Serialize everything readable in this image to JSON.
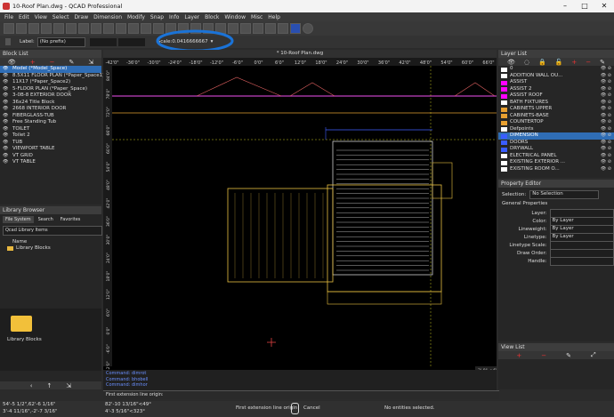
{
  "app": {
    "title": "10-Roof  Plan.dwg - QCAD Professional"
  },
  "menu": [
    "File",
    "Edit",
    "View",
    "Select",
    "Draw",
    "Dimension",
    "Modify",
    "Snap",
    "Info",
    "Layer",
    "Block",
    "Window",
    "Misc",
    "Help"
  ],
  "options": {
    "label_caption": "Label:",
    "label_value": "(No prefix)",
    "scale_caption": "Scale:",
    "scale_value": "0.0416666667"
  },
  "doc_tab": "* 10-Roof  Plan.dwg",
  "ruler_top": [
    "-42'0\"",
    "-36'0\"",
    "-30'0\"",
    "-24'0\"",
    "-18'0\"",
    "-12'0\"",
    "-6'0\"",
    "0'0\"",
    "6'0\"",
    "12'0\"",
    "18'0\"",
    "24'0\"",
    "30'0\"",
    "36'0\"",
    "42'0\"",
    "48'0\"",
    "54'0\"",
    "60'0\"",
    "66'0\""
  ],
  "ruler_left": [
    "84'0\"",
    "78'0\"",
    "72'0\"",
    "66'0\"",
    "60'0\"",
    "54'0\"",
    "48'0\"",
    "42'0\"",
    "36'0\"",
    "30'0\"",
    "24'0\"",
    "18'0\"",
    "12'0\"",
    "6'0\"",
    "0'0\"",
    "-6'0\"",
    "-12'0\""
  ],
  "block_list": {
    "title": "Block List",
    "items": [
      "Model (*Model_Space)",
      "8.5X11 FLOOR PLAN (*Paper_Space1)",
      "11X17 (*Paper_Space2)",
      "5-FLOOR PLAN (*Paper_Space)",
      "3-0B-8 EXTERIOR DOOR",
      "36x24 Title Block",
      "2668 INTERIOR DOOR",
      "FIBERGLASS-TUB",
      "Free Standing Tub",
      "TOILET",
      "Toilet 2",
      "TUB",
      "VIEWPORT TABLE",
      "VT GRID",
      "VT TABLE"
    ]
  },
  "library": {
    "title": "Library Browser",
    "tabs": [
      "File System",
      "Search",
      "Favorites"
    ],
    "source": "Qcad Library Items",
    "col_name": "Name",
    "tree_item": "Library Blocks",
    "preview_label": "Library Blocks"
  },
  "layer_list": {
    "title": "Layer List",
    "items": [
      {
        "name": "0",
        "color": "#ffffff"
      },
      {
        "name": "ADDITION WALL OU...",
        "color": "#ffffff"
      },
      {
        "name": "ASSIST",
        "color": "#ff00ff"
      },
      {
        "name": "ASSIST 2",
        "color": "#ff00ff"
      },
      {
        "name": "ASSIST ROOF",
        "color": "#ff00ff"
      },
      {
        "name": "BATH FIXTURES",
        "color": "#ffffff"
      },
      {
        "name": "CABINETS UPPER",
        "color": "#e8a030"
      },
      {
        "name": "CABINETS-BASE",
        "color": "#e8a030"
      },
      {
        "name": "COUNTERTOP",
        "color": "#e8a030"
      },
      {
        "name": "Defpoints",
        "color": "#ffffff"
      },
      {
        "name": "DIMENSION",
        "color": "#3a5dff"
      },
      {
        "name": "DOORS",
        "color": "#3a5dff"
      },
      {
        "name": "DRYWALL",
        "color": "#3a5dff"
      },
      {
        "name": "ELECTRICAL PANEL",
        "color": "#ffffff"
      },
      {
        "name": "EXISTING EXTERIOR ...",
        "color": "#ffffff"
      },
      {
        "name": "EXISTING ROOM O...",
        "color": "#ffffff"
      }
    ],
    "selected": 10
  },
  "property_editor": {
    "title": "Property Editor",
    "selection_caption": "Selection:",
    "selection_value": "No Selection",
    "group": "General Properties",
    "rows": [
      {
        "k": "Layer:",
        "v": ""
      },
      {
        "k": "Color:",
        "v": "By Layer"
      },
      {
        "k": "Lineweight:",
        "v": "By Layer"
      },
      {
        "k": "Linetype:",
        "v": "By Layer"
      },
      {
        "k": "Linetype Scale:",
        "v": ""
      },
      {
        "k": "Draw Order:",
        "v": ""
      },
      {
        "k": "Handle:",
        "v": ""
      }
    ]
  },
  "view_list": {
    "title": "View List"
  },
  "cmdline": {
    "lines": [
      "Command: dimrot",
      "Command: bhobell",
      "Command: dimhor"
    ],
    "prompt": "First extension line origin:"
  },
  "status": {
    "coord1": "54'-5 1/2\",62'-6 1/16\"",
    "coord2": "3'-4 11/16\",-2'-7 3/16\"",
    "coord3": "82'-10 13/16\"<49°",
    "coord4": "4'-3 5/16\"<323°",
    "left_mouse": "First extension line origin",
    "right_mouse": "Cancel",
    "selection": "No entities selected.",
    "scale_readout": "3'-0\" < 6'-0\""
  }
}
